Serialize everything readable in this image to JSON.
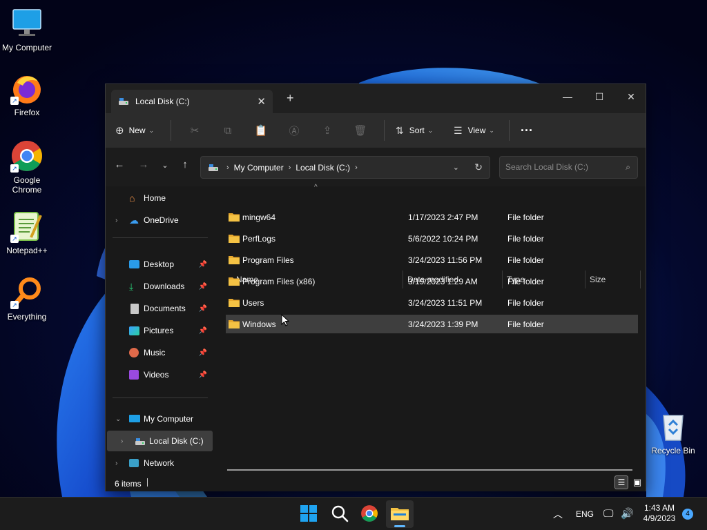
{
  "desktop": {
    "icons": [
      {
        "label": "My Computer",
        "icon": "monitor-icon"
      },
      {
        "label": "Firefox",
        "icon": "firefox-icon"
      },
      {
        "label": "Google Chrome",
        "icon": "chrome-icon"
      },
      {
        "label": "Notepad++",
        "icon": "notepadpp-icon"
      },
      {
        "label": "Everything",
        "icon": "everything-search-icon"
      },
      {
        "label": "Recycle Bin",
        "icon": "recycle-bin-icon"
      }
    ]
  },
  "explorer": {
    "tab_title": "Local Disk (C:)",
    "toolbar": {
      "new_label": "New",
      "sort_label": "Sort",
      "view_label": "View",
      "more_label": "···"
    },
    "address": {
      "crumbs": [
        "My Computer",
        "Local Disk (C:)"
      ]
    },
    "search": {
      "placeholder": "Search Local Disk (C:)"
    },
    "sidebar": {
      "items": [
        {
          "label": "Home",
          "icon": "home-icon"
        },
        {
          "label": "OneDrive",
          "icon": "cloud-icon"
        },
        {
          "label": "Desktop",
          "icon": "desktop-folder-icon"
        },
        {
          "label": "Downloads",
          "icon": "download-icon"
        },
        {
          "label": "Documents",
          "icon": "document-icon"
        },
        {
          "label": "Pictures",
          "icon": "picture-icon"
        },
        {
          "label": "Music",
          "icon": "music-icon"
        },
        {
          "label": "Videos",
          "icon": "video-icon"
        },
        {
          "label": "My Computer",
          "icon": "monitor-icon"
        },
        {
          "label": "Local Disk (C:)",
          "icon": "drive-icon"
        },
        {
          "label": "Network",
          "icon": "network-icon"
        }
      ]
    },
    "columns": {
      "name": "Name",
      "date": "Date modified",
      "type": "Type",
      "size": "Size"
    },
    "files": [
      {
        "name": "mingw64",
        "date": "1/17/2023 2:47 PM",
        "type": "File folder"
      },
      {
        "name": "PerfLogs",
        "date": "5/6/2022 10:24 PM",
        "type": "File folder"
      },
      {
        "name": "Program Files",
        "date": "3/24/2023 11:56 PM",
        "type": "File folder"
      },
      {
        "name": "Program Files (x86)",
        "date": "3/19/2023 1:29 AM",
        "type": "File folder"
      },
      {
        "name": "Users",
        "date": "3/24/2023 11:51 PM",
        "type": "File folder"
      },
      {
        "name": "Windows",
        "date": "3/24/2023 1:39 PM",
        "type": "File folder"
      }
    ],
    "status": {
      "item_count": "6 items"
    }
  },
  "taskbar": {
    "language": "ENG",
    "time": "1:43 AM",
    "date": "4/9/2023",
    "notification_count": "4"
  },
  "colors": {
    "accent": "#0078d4",
    "folder": "#f4c244",
    "selected_row": "#3e3e3e"
  }
}
